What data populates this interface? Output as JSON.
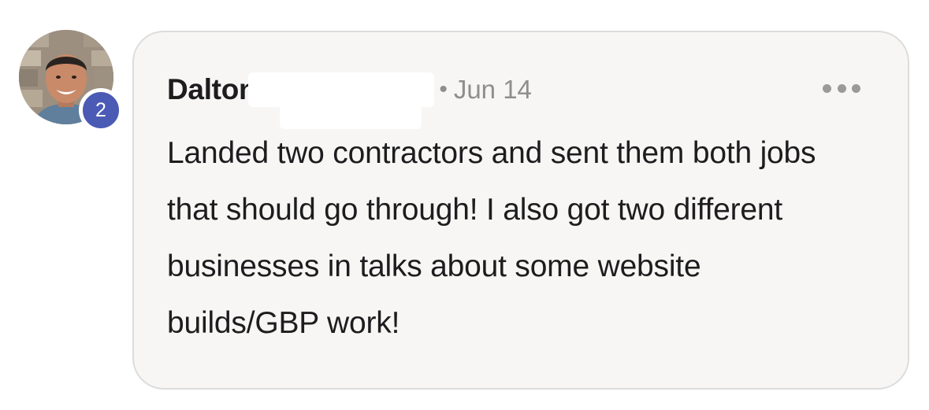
{
  "comment": {
    "author": {
      "name": "Dalton",
      "avatar_icon": "profile-photo",
      "level_badge": "2",
      "badge_color": "#4a5ab5"
    },
    "separator": "•",
    "date": "Jun 14",
    "more_icon": "ellipsis-icon",
    "text": "Landed two contractors and sent them both jobs that should go through! I also got two different businesses in talks about some website builds/GBP work!"
  }
}
